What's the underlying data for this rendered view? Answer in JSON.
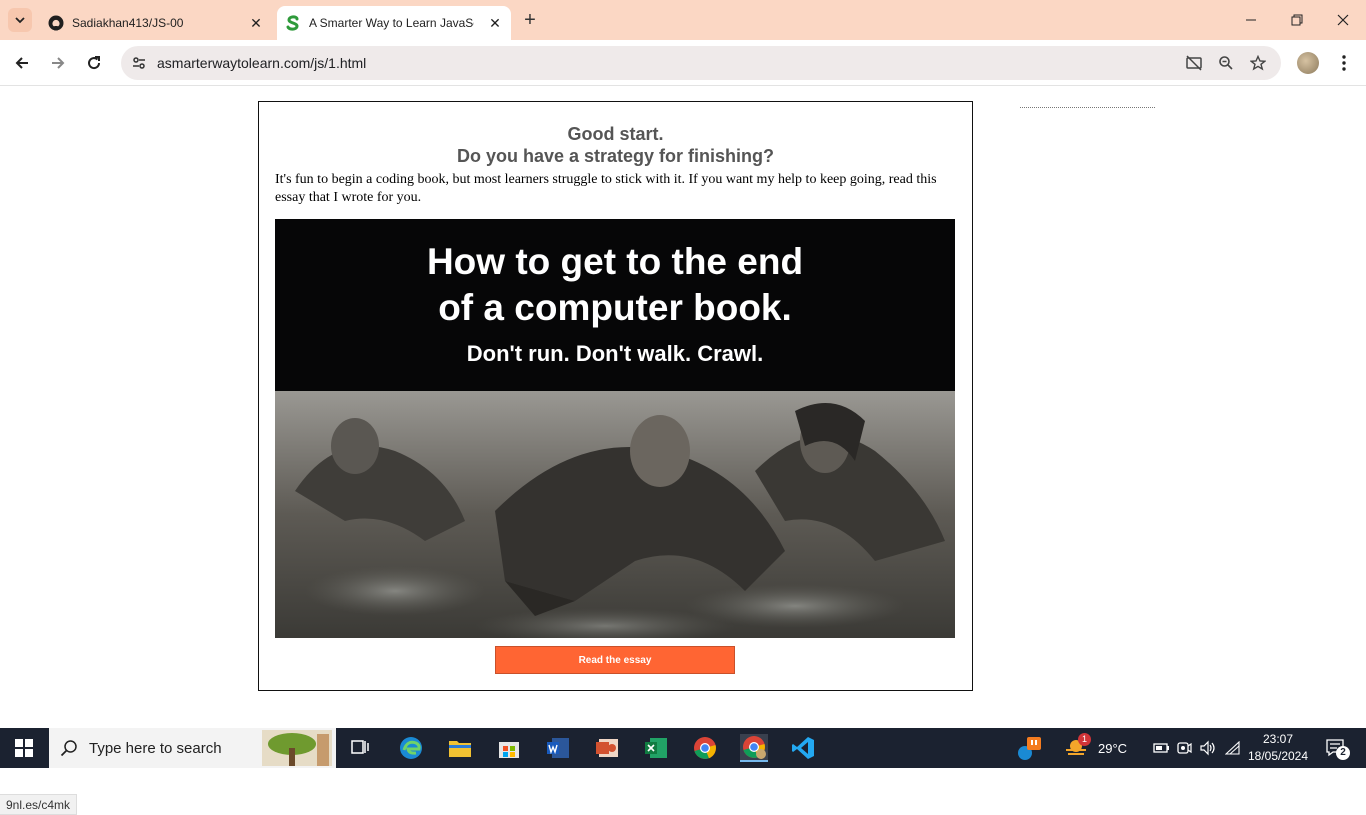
{
  "browser": {
    "tabs": [
      {
        "title": "Sadiakhan413/JS-00",
        "icon": "github-icon"
      },
      {
        "title": "A Smarter Way to Learn JavaScript",
        "icon": "asmarterway-icon",
        "active": true
      }
    ],
    "url": "asmarterwaytolearn.com/js/1.html"
  },
  "page": {
    "heading": "Good start.",
    "subheading": "Do you have a strategy for finishing?",
    "intro": "It's fun to begin a coding book, but most learners struggle to stick with it. If you want my help to keep going, read this essay that I wrote for you.",
    "hero": {
      "title_line1": "How to get to the end",
      "title_line2": "of a computer book.",
      "tagline": "Don't run. Don't walk. Crawl."
    },
    "cta_label": "Read the essay",
    "status_link": "9nl.es/c4mk"
  },
  "taskbar": {
    "search_placeholder": "Type here to search",
    "weather": "29°C",
    "time": "23:07",
    "date": "18/05/2024",
    "notification_count": "2",
    "weather_badge": "1"
  },
  "colors": {
    "tabstrip": "#fbd7c4",
    "cta": "#ff6533",
    "taskbar": "#1b2230"
  }
}
